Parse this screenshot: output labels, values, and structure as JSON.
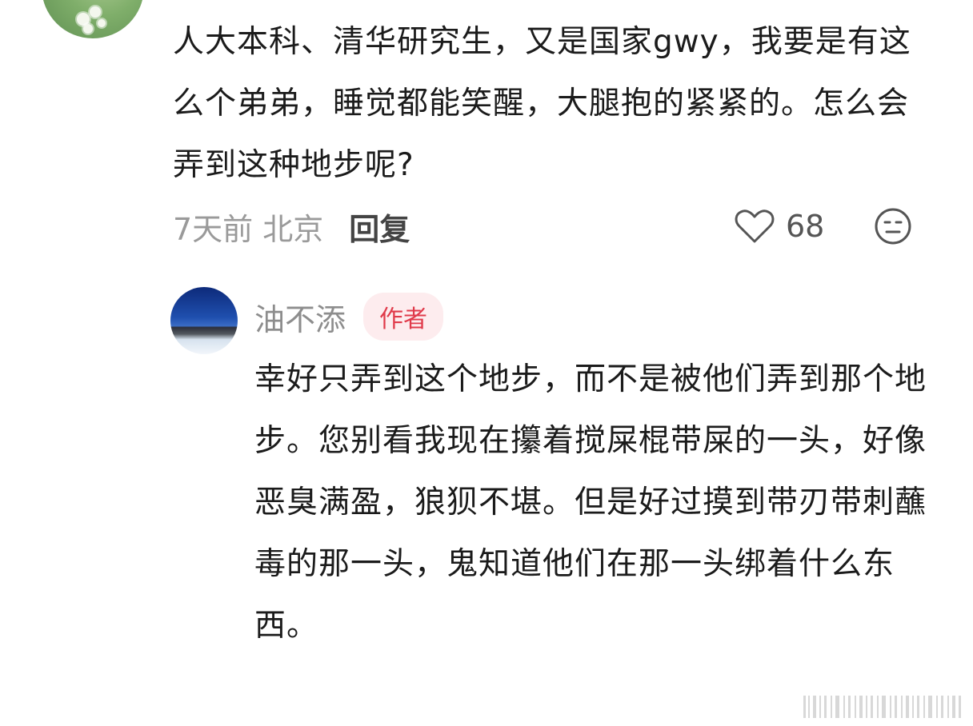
{
  "comment": {
    "text": "人大本科、清华研究生，又是国家gwy，我要是有这么个弟弟，睡觉都能笑醒，大腿抱的紧紧的。怎么会弄到这种地步呢?",
    "time_location": "7天前 北京",
    "reply_label": "回复",
    "like_count": "68",
    "like_icon": "heart-outline-icon",
    "emoji_icon": "neutral-face-icon"
  },
  "reply": {
    "author": "油不添",
    "badge": "作者",
    "text": "幸好只弄到这个地步，而不是被他们弄到那个地步。您别看我现在攥着搅屎棍带屎的一头，好像恶臭满盈，狼狈不堪。但是好过摸到带刃带刺蘸毒的那一头，鬼知道他们在那一头绑着什么东西。"
  },
  "colors": {
    "text": "#1b1b1b",
    "meta": "#9a9a9a",
    "author": "#8d8d8d",
    "badge_bg": "#fdecee",
    "badge_text": "#e03a4a"
  }
}
